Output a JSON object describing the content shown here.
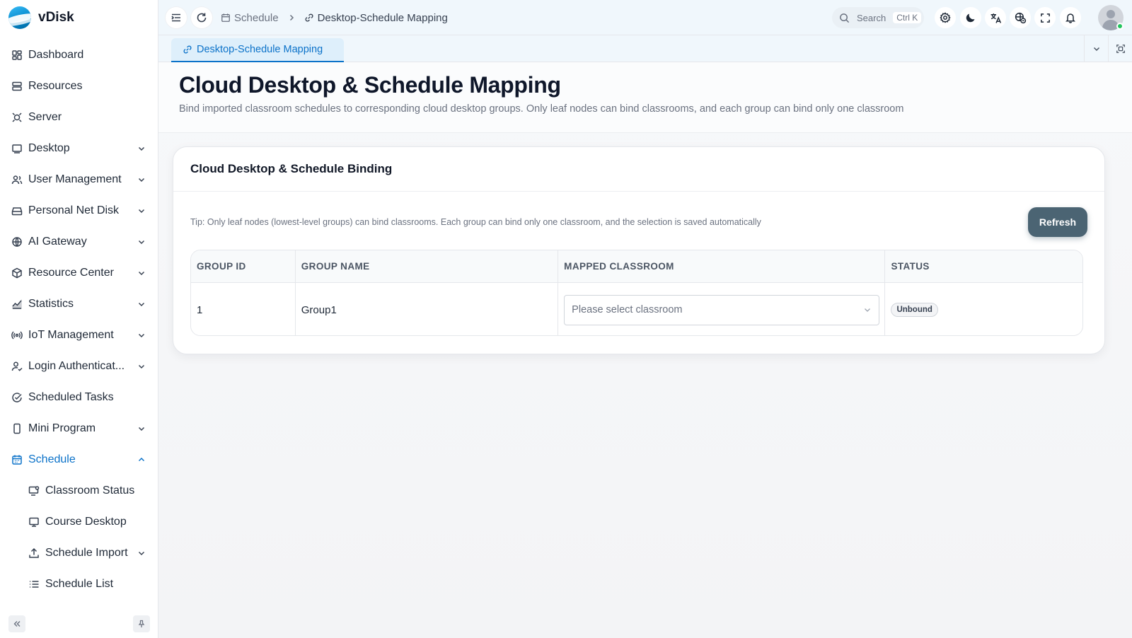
{
  "app": {
    "name": "vDisk"
  },
  "sidebar": {
    "items": [
      {
        "label": "Dashboard",
        "icon": "dashboard-icon",
        "expandable": false
      },
      {
        "label": "Resources",
        "icon": "server-stack-icon",
        "expandable": false
      },
      {
        "label": "Server",
        "icon": "server-icon",
        "expandable": false
      },
      {
        "label": "Desktop",
        "icon": "desktop-icon",
        "expandable": true
      },
      {
        "label": "User Management",
        "icon": "users-icon",
        "expandable": true
      },
      {
        "label": "Personal Net Disk",
        "icon": "disk-icon",
        "expandable": true
      },
      {
        "label": "AI Gateway",
        "icon": "globe-icon",
        "expandable": true
      },
      {
        "label": "Resource Center",
        "icon": "box-icon",
        "expandable": true
      },
      {
        "label": "Statistics",
        "icon": "chart-icon",
        "expandable": true
      },
      {
        "label": "IoT Management",
        "icon": "iot-icon",
        "expandable": true
      },
      {
        "label": "Login Authenticat...",
        "icon": "user-check-icon",
        "expandable": true
      },
      {
        "label": "Scheduled Tasks",
        "icon": "task-check-icon",
        "expandable": false
      },
      {
        "label": "Mini Program",
        "icon": "phone-icon",
        "expandable": true
      },
      {
        "label": "Schedule",
        "icon": "calendar-icon",
        "expandable": true,
        "active": true
      }
    ],
    "schedule_children": [
      {
        "label": "Classroom Status",
        "icon": "classroom-icon"
      },
      {
        "label": "Course Desktop",
        "icon": "monitor-icon"
      },
      {
        "label": "Schedule Import",
        "icon": "upload-icon",
        "expandable": true
      },
      {
        "label": "Schedule List",
        "icon": "list-icon"
      }
    ]
  },
  "header": {
    "breadcrumb": [
      {
        "label": "Schedule",
        "icon": "calendar-icon"
      },
      {
        "label": "Desktop-Schedule Mapping",
        "icon": "link-icon"
      }
    ],
    "search": {
      "label": "Search",
      "shortcut": "Ctrl K"
    }
  },
  "tabs": [
    {
      "label": "Desktop-Schedule Mapping",
      "icon": "link-icon",
      "active": true
    }
  ],
  "page": {
    "title": "Cloud Desktop & Schedule Mapping",
    "description": "Bind imported classroom schedules to corresponding cloud desktop groups. Only leaf nodes can bind classrooms, and each group can bind only one classroom"
  },
  "card": {
    "title": "Cloud Desktop & Schedule Binding",
    "tip": "Tip: Only leaf nodes (lowest-level groups) can bind classrooms. Each group can bind only one classroom, and the selection is saved automatically",
    "refresh_label": "Refresh",
    "table": {
      "columns": [
        "GROUP ID",
        "GROUP NAME",
        "MAPPED CLASSROOM",
        "STATUS"
      ],
      "rows": [
        {
          "group_id": "1",
          "group_name": "Group1",
          "classroom_placeholder": "Please select classroom",
          "status": "Unbound"
        }
      ]
    }
  },
  "colors": {
    "accent": "#0b72c9",
    "refresh_button": "#4b6473",
    "online": "#22c55e"
  }
}
